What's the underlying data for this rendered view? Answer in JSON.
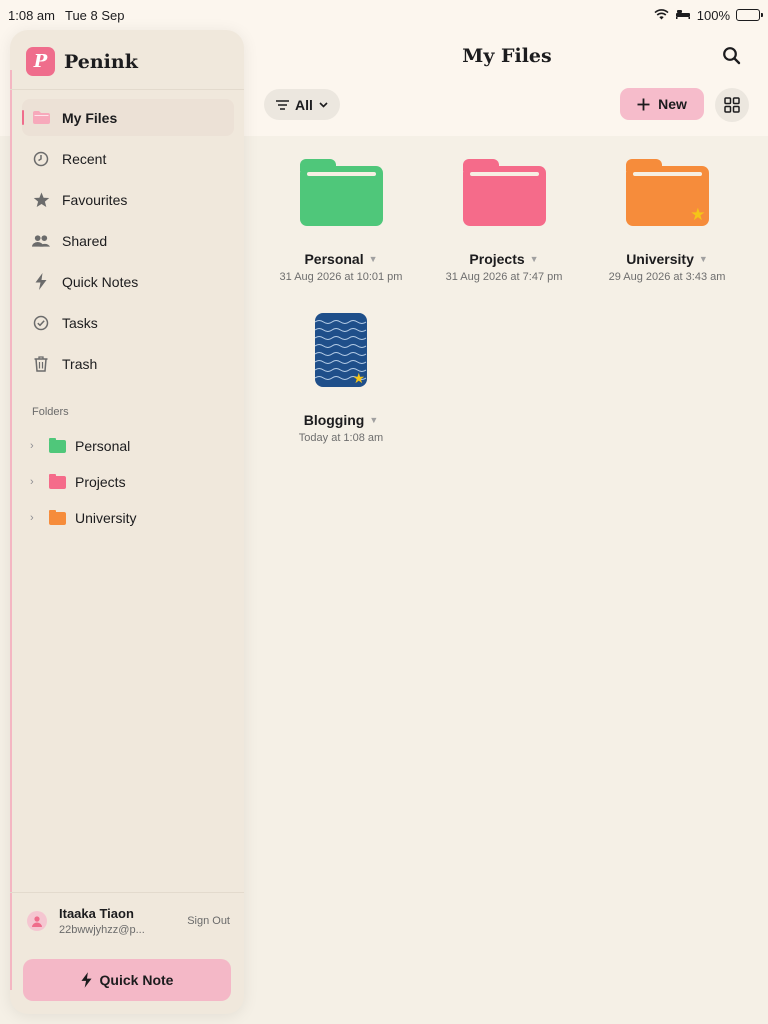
{
  "status_bar": {
    "time": "1:08 am",
    "date": "Tue 8 Sep",
    "battery": "100%"
  },
  "header": {
    "title": "My Files",
    "filter_label": "All",
    "new_label": "New"
  },
  "brand": {
    "name": "Penink",
    "logo_letter": "P",
    "logo_color": "#ef6d8c"
  },
  "sidebar": {
    "items": [
      {
        "label": "My Files",
        "icon": "folder-icon",
        "active": true
      },
      {
        "label": "Recent",
        "icon": "clock-icon"
      },
      {
        "label": "Favourites",
        "icon": "star-icon"
      },
      {
        "label": "Shared",
        "icon": "people-icon"
      },
      {
        "label": "Quick Notes",
        "icon": "bolt-icon"
      },
      {
        "label": "Tasks",
        "icon": "check-circle-icon"
      },
      {
        "label": "Trash",
        "icon": "trash-icon"
      }
    ],
    "folders_title": "Folders",
    "folders": [
      {
        "label": "Personal",
        "color": "#4fc77a"
      },
      {
        "label": "Projects",
        "color": "#f56b8a"
      },
      {
        "label": "University",
        "color": "#f68c3b"
      }
    ],
    "user": {
      "name": "Itaaka Tiaon",
      "email": "22bwwjyhzz@p...",
      "sign_out": "Sign Out"
    },
    "quick_note_label": "Quick Note"
  },
  "files": [
    {
      "name": "Personal",
      "date": "31 Aug 2026 at 10:01 pm",
      "type": "folder",
      "color": "#4fc77a",
      "starred": false
    },
    {
      "name": "Projects",
      "date": "31 Aug 2026 at 7:47 pm",
      "type": "folder",
      "color": "#f56b8a",
      "starred": false
    },
    {
      "name": "University",
      "date": "29 Aug 2026 at 3:43 am",
      "type": "folder",
      "color": "#f68c3b",
      "starred": true
    },
    {
      "name": "Blogging",
      "date": "Today at 1:08 am",
      "type": "notebook",
      "color": "#1f4f8a",
      "starred": true
    }
  ]
}
